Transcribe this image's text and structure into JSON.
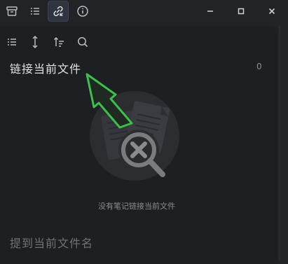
{
  "header": {
    "tabs": [
      {
        "icon": "archive-icon",
        "active": false
      },
      {
        "icon": "outline-list-icon",
        "active": false
      },
      {
        "icon": "link-icon",
        "active": true
      },
      {
        "icon": "info-icon",
        "active": false
      }
    ],
    "window_controls": [
      "minimize-icon",
      "maximize-icon",
      "close-icon"
    ]
  },
  "pane_toolbar": {
    "icons": [
      "list-icon",
      "expand-vertical-icon",
      "sort-icon",
      "search-icon"
    ]
  },
  "backlinks": {
    "title": "链接当前文件",
    "count": "0",
    "empty_message": "没有笔记链接当前文件"
  },
  "unlinked": {
    "title": "提到当前文件名"
  },
  "colors": {
    "background": "#1e1f22",
    "topbar": "#222326",
    "annotation_arrow": "#3cc04b",
    "muted_text": "#8a8d92"
  }
}
